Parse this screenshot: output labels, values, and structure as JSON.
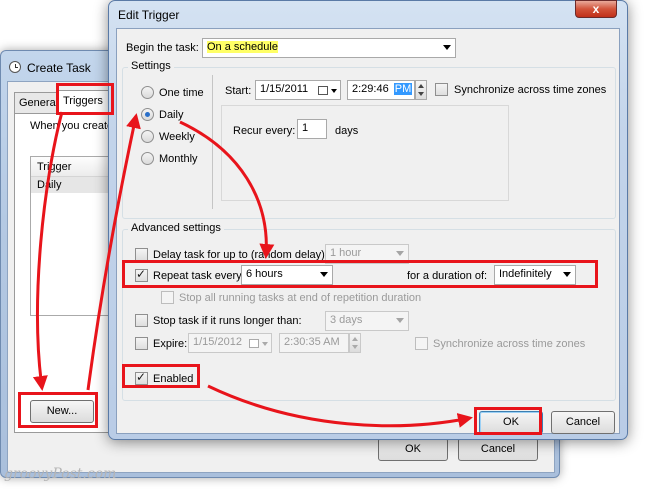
{
  "create_task": {
    "title": "Create Task",
    "tabs": [
      {
        "label": "Genera"
      },
      {
        "label": "Triggers"
      }
    ],
    "description": "When you create",
    "column_header": "Trigger",
    "row_value": "Daily",
    "new_button": "New...",
    "ok_button": "OK",
    "cancel_button": "Cancel"
  },
  "edit_trigger": {
    "title": "Edit Trigger",
    "close_label": "x",
    "begin_label": "Begin the task:",
    "begin_value": "On a schedule",
    "settings_title": "Settings",
    "radios": [
      {
        "label": "One time",
        "selected": false
      },
      {
        "label": "Daily",
        "selected": true
      },
      {
        "label": "Weekly",
        "selected": false
      },
      {
        "label": "Monthly",
        "selected": false
      }
    ],
    "start_label": "Start:",
    "start_date": "1/15/2011",
    "start_time": "2:29:46",
    "start_ampm": "PM",
    "sync_label": "Synchronize across time zones",
    "recur_label": "Recur every:",
    "recur_value": "1",
    "recur_unit": "days",
    "advanced_title": "Advanced settings",
    "delay_label": "Delay task for up to (random delay):",
    "delay_value": "1 hour",
    "repeat_label": "Repeat task every:",
    "repeat_value": "6 hours",
    "duration_label": "for a duration of:",
    "duration_value": "Indefinitely",
    "stop_all_label": "Stop all running tasks at end of repetition duration",
    "stop_longer_label": "Stop task if it runs longer than:",
    "stop_longer_value": "3 days",
    "expire_label": "Expire:",
    "expire_date": "1/15/2012",
    "expire_time": "2:30:35 AM",
    "expire_sync_label": "Synchronize across time zones",
    "enabled_label": "Enabled",
    "ok_button": "OK",
    "cancel_button": "Cancel"
  },
  "watermark": "groovyPost.com",
  "colors": {
    "annotation_red": "#e8141b",
    "highlight_yellow": "#ffff66",
    "selection_blue": "#3399ff"
  },
  "icons": [
    "clock-icon",
    "calendar-icon",
    "close-icon",
    "chevron-down-icon",
    "spin-arrows-icon",
    "checkmark-icon"
  ]
}
